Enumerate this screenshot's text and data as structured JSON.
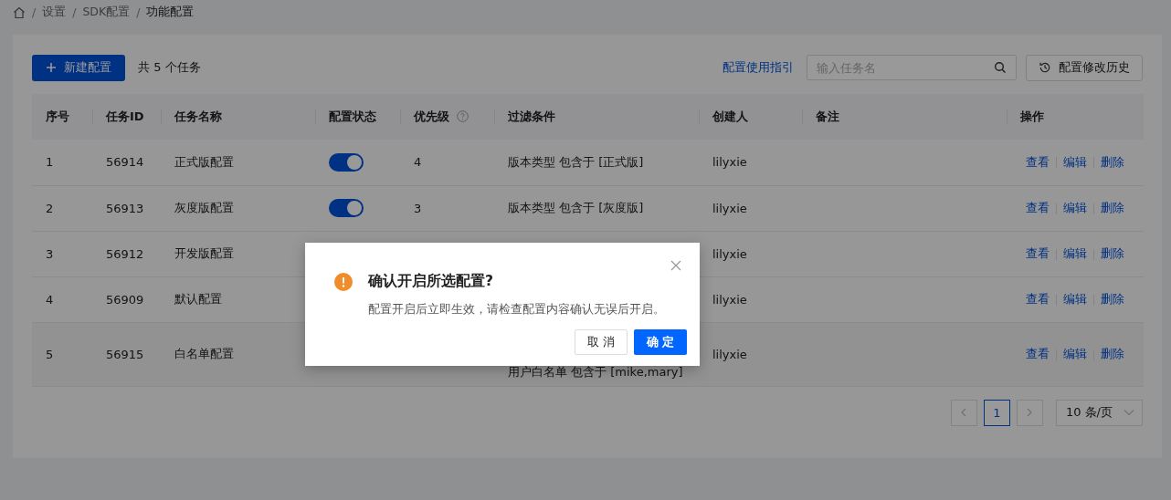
{
  "breadcrumb": [
    {
      "kind": "separator",
      "text": "/"
    },
    {
      "kind": "link",
      "text": "设置"
    },
    {
      "kind": "separator",
      "text": "/"
    },
    {
      "kind": "link",
      "text": "SDK配置"
    },
    {
      "kind": "separator",
      "text": "/"
    },
    {
      "kind": "current",
      "text": "功能配置"
    }
  ],
  "toolbar": {
    "new_button": "新建配置",
    "total": "共 5 个任务",
    "guide_link": "配置使用指引",
    "search": {
      "placeholder": "输入任务名"
    },
    "history_button": "配置修改历史"
  },
  "table": {
    "columns": [
      "序号",
      "任务ID",
      "任务名称",
      "配置状态",
      "优先级",
      "过滤条件",
      "创建人",
      "备注",
      "操作"
    ],
    "rows": [
      {
        "index": "1",
        "id": "56914",
        "name": "正式版配置",
        "enabled": true,
        "priority": "4",
        "filter": "版本类型 包含于 [正式版]",
        "creator": "lilyxie",
        "actions": [
          "查看",
          "编辑",
          "删除"
        ]
      },
      {
        "index": "2",
        "id": "56913",
        "name": "灰度版配置",
        "enabled": true,
        "priority": "3",
        "filter": "版本类型 包含于 [灰度版]",
        "creator": "lilyxie",
        "actions": [
          "查看",
          "编辑",
          "删除"
        ]
      },
      {
        "index": "3",
        "id": "56912",
        "name": "开发版配置",
        "creator": "lilyxie",
        "actions": [
          "查看",
          "编辑",
          "删除"
        ]
      },
      {
        "index": "4",
        "id": "56909",
        "name": "默认配置",
        "creator": "lilyxie",
        "actions": [
          "查看",
          "编辑",
          "删除"
        ]
      },
      {
        "index": "5",
        "id": "56915",
        "name": "白名单配置",
        "filter": "用户白名单 包含于 [mike,mary]",
        "creator": "lilyxie",
        "actions": [
          "查看",
          "编辑",
          "删除"
        ]
      }
    ]
  },
  "pagination": {
    "pages": [
      {
        "label": "1",
        "selected": true
      }
    ],
    "page_size": "10 条/页"
  },
  "dialog": {
    "title": "确认开启所选配置?",
    "message": "配置开启后立即生效，请检查配置内容确认无误后开启。",
    "cancel": "取 消",
    "confirm": "确 定"
  }
}
